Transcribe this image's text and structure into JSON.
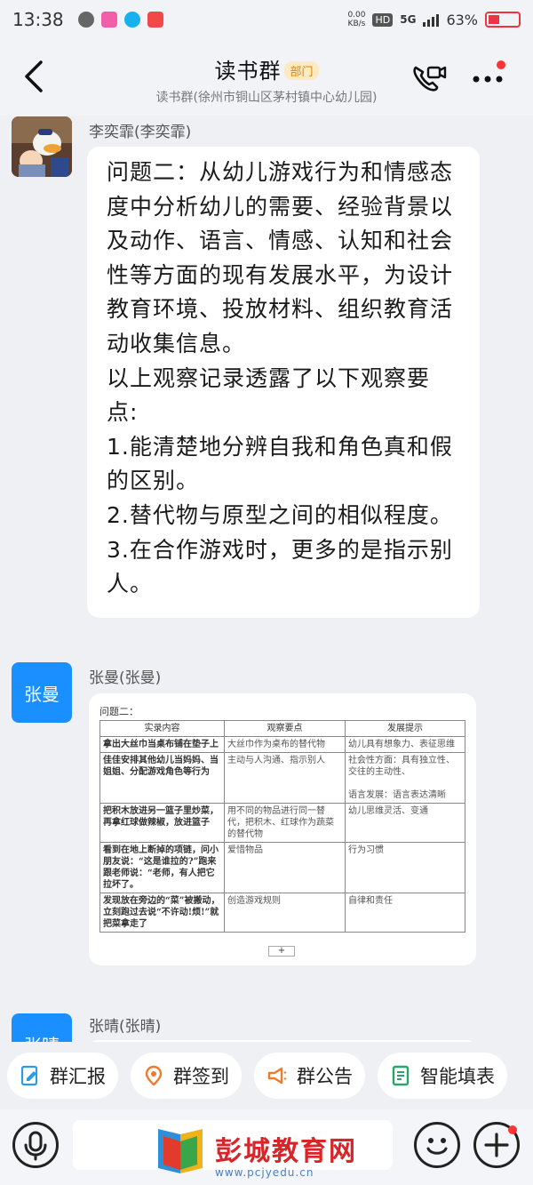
{
  "status_bar": {
    "time": "13:38",
    "net_speed": "0.00\nKB/s",
    "hd": "HD",
    "network": "5G",
    "battery": "63%"
  },
  "header": {
    "title": "读书群",
    "badge": "部门",
    "subtitle": "读书群(徐州市铜山区茅村镇中心幼儿园)"
  },
  "messages": [
    {
      "sender": "李奕霏(李奕霏)",
      "lines": [
        "问题二：从幼儿游戏行为和情感态度中分析幼儿的需要、经验背景以及动作、语言、情感、认知和社会性等方面的现有发展水平，为设计教育环境、投放材料、组织教育活动收集信息。",
        "以上观察记录透露了以下观察要点:",
        "1.能清楚地分辨自我和角色真和假的区别。",
        "2.替代物与原型之间的相似程度。",
        "3.在合作游戏时，更多的是指示别人。"
      ]
    },
    {
      "sender": "张曼(张曼)",
      "avatar_text": "张曼",
      "doc_title": "问题二：",
      "table_headers": [
        "实录内容",
        "观察要点",
        "发展提示"
      ],
      "table_rows": [
        [
          "拿出大丝巾当桌布铺在垫子上",
          "大丝巾作为桌布的替代物",
          "幼儿具有想象力、表征思维"
        ],
        [
          "佳佳安排其他幼儿当妈妈、当姐姐、分配游戏角色等行为",
          "主动与人沟通、指示别人",
          "社会性方面：具有独立性、交往的主动性、\n\n语言发展：语言表达清晰"
        ],
        [
          "把积木放进另一篮子里炒菜，再拿红球做辣椒，放进篮子",
          "用不同的物品进行同一替代，把积木、红球作为蔬菜的替代物",
          "幼儿思维灵活、变通"
        ],
        [
          "看到在地上断掉的项链，问小朋友说：“这是谁拉的?”跑来跟老师说：“老师，有人把它拉坏了。",
          "爱惜物品",
          "行为习惯"
        ],
        [
          "发现放在旁边的“菜”被搬动，立刻跑过去说“不许动!烦!”就把菜拿走了",
          "创造游戏规则",
          "自律和责任"
        ]
      ],
      "plus_label": "+"
    },
    {
      "sender": "张晴(张晴)",
      "avatar_text": "张晴"
    }
  ],
  "actions": [
    {
      "label": "群汇报",
      "icon": "report-icon",
      "color": "#2c9be0"
    },
    {
      "label": "群签到",
      "icon": "location-pin-icon",
      "color": "#f07a2a"
    },
    {
      "label": "群公告",
      "icon": "megaphone-icon",
      "color": "#f07a2a"
    },
    {
      "label": "智能填表",
      "icon": "form-icon",
      "color": "#2aa56a"
    }
  ],
  "watermark": {
    "text": "彭城教育网",
    "url": "www.pcjyedu.cn"
  }
}
